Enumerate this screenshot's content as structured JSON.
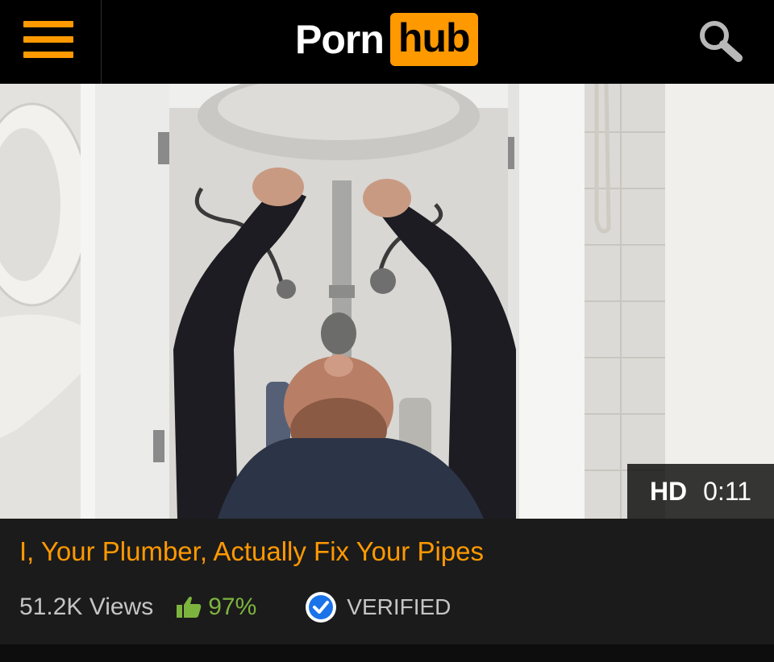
{
  "header": {
    "logo_left": "Porn",
    "logo_right": "hub",
    "menu_icon": "hamburger-menu-icon",
    "search_icon": "search-icon"
  },
  "video": {
    "quality": "HD",
    "duration": "0:11"
  },
  "info": {
    "title": "I, Your Plumber, Actually Fix Your Pipes",
    "views": "51.2K Views",
    "rating": "97%",
    "rating_icon": "thumbs-up-icon",
    "verified_label": "VERIFIED",
    "verified_icon": "verified-check-icon"
  },
  "colors": {
    "accent": "#ff9900",
    "header_bg": "#000000",
    "page_bg": "#1b1b1b",
    "rating_green": "#7db43e",
    "verified_blue": "#1a73e8"
  }
}
